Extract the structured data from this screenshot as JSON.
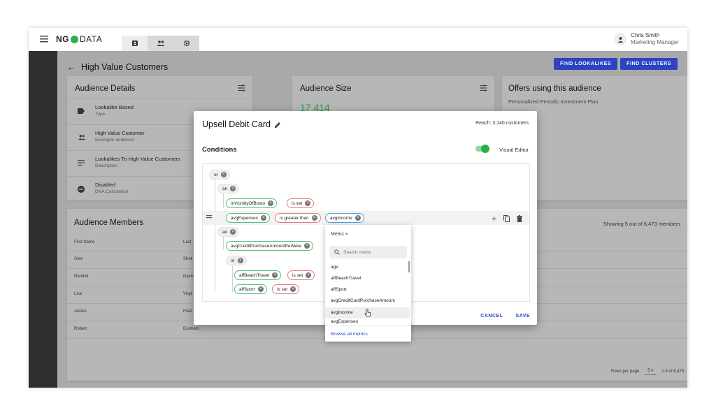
{
  "app": {
    "logo_prefix": "NG",
    "logo_suffix": "DATA"
  },
  "user": {
    "name": "Chris Smith",
    "role": "Marketing Manager"
  },
  "page": {
    "title": "High Value Customers",
    "buttons": {
      "find_lookalikes": "FIND LOOKALIKES",
      "find_clusters": "FIND CLUSTERS"
    }
  },
  "audience_details": {
    "title": "Audience Details",
    "rows": [
      {
        "value": "Lookalike Based",
        "label": "Type"
      },
      {
        "value": "High Value Customer",
        "label": "Exemplar audience"
      },
      {
        "value": "Lookalikes To High Value Customers",
        "label": "Description"
      },
      {
        "value": "Disabled",
        "label": "DNA Calculation"
      }
    ]
  },
  "audience_size": {
    "title": "Audience Size",
    "value": "17,414"
  },
  "offers": {
    "title": "Offers using this audience",
    "item": "Personalized Periodic Investment Plan"
  },
  "members": {
    "title": "Audience Members",
    "showing": "Showing 5 out of 6,473 members",
    "columns": [
      "First Name",
      "Last"
    ],
    "rows": [
      {
        "first": "Glen",
        "last": "Shell"
      },
      {
        "first": "Randall",
        "last": "Davis"
      },
      {
        "first": "Lisa",
        "last": "Virgil"
      },
      {
        "first": "James",
        "last": "Frazi"
      },
      {
        "first": "Robert",
        "last": "Dunham"
      }
    ],
    "pager": {
      "rows_label": "Rows per page",
      "rows_value": "5",
      "range": "1-5 of 6,473"
    }
  },
  "modal": {
    "title": "Upsell Debit Card",
    "reach": "Reach:  3,140 customers",
    "conditions_label": "Conditions",
    "visual_editor_label": "Visual Editor",
    "cancel": "CANCEL",
    "save": "SAVE",
    "tree": {
      "op_or": "or",
      "op_an1": "an",
      "c1_field": "inVicinityOfBosto",
      "c1_op": "is set",
      "c2_field": "avgExpenses",
      "c2_op": "is greater than",
      "c2_value": "avgIncome",
      "op_an2": "an",
      "c3_field": "avgCreditPurchaseAmountPerWee",
      "op_or2": "or",
      "c4_field": "affBeachTravel",
      "c4_op": "is set",
      "c5_field": "affSport",
      "c5_op": "is set"
    }
  },
  "dropdown": {
    "header": "Metric",
    "search_placeholder": "Search metric",
    "items": [
      "age",
      "affBeachTravel",
      "affSport",
      "avgCreditCardPurchaseAmount",
      "avgIncome",
      "avgExpenses"
    ],
    "browse_all": "Browse all metrics"
  }
}
